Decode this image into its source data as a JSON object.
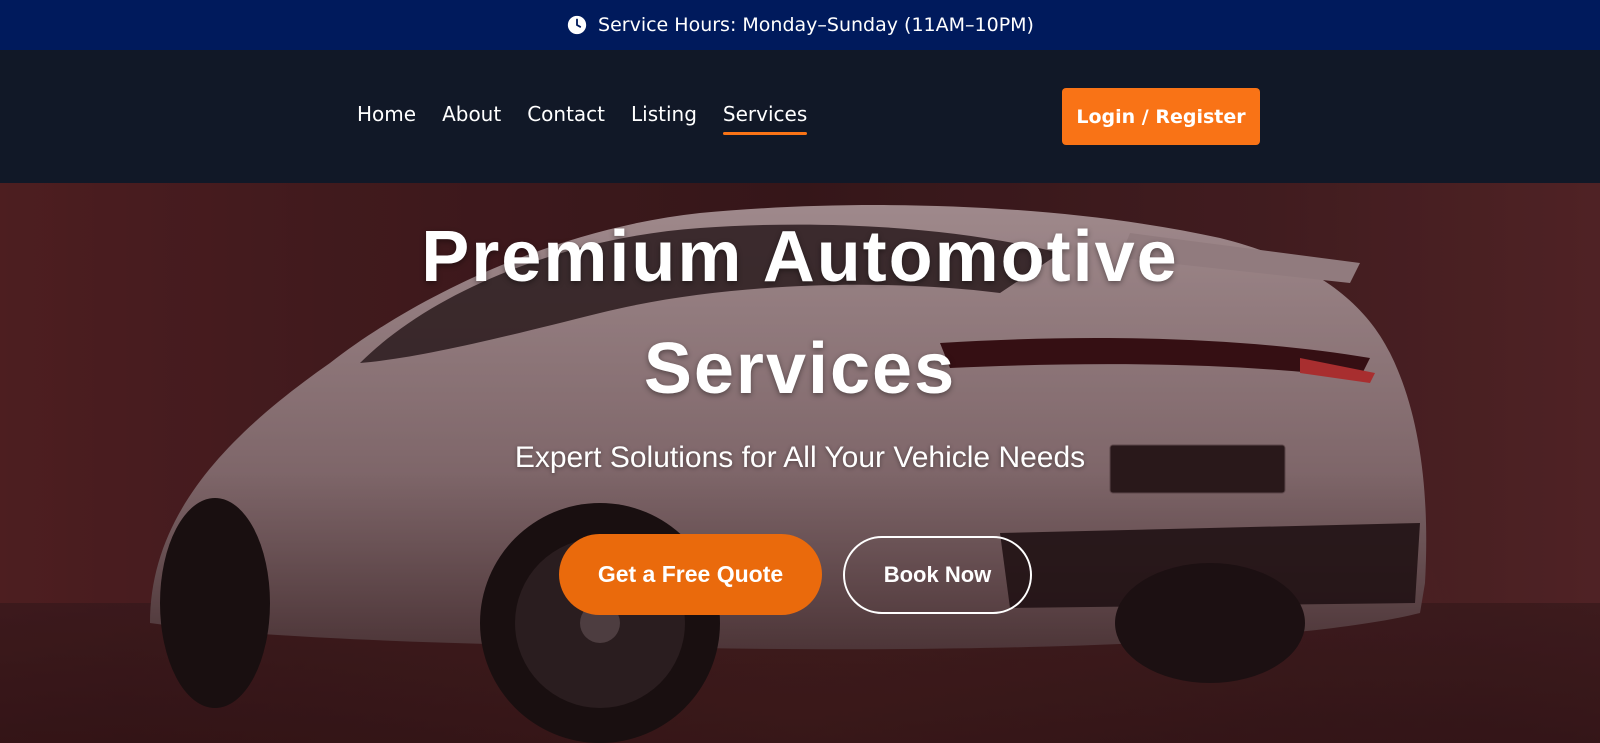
{
  "topbar": {
    "icon": "clock-icon",
    "text": "Service Hours: Monday–Sunday (11AM–10PM)"
  },
  "nav": {
    "links": [
      {
        "label": "Home"
      },
      {
        "label": "About"
      },
      {
        "label": "Contact"
      },
      {
        "label": "Listing"
      },
      {
        "label": "Services",
        "active": true
      }
    ],
    "login_label": "Login / Register"
  },
  "hero": {
    "title_line1": "Premium Automotive",
    "title_line2": "Services",
    "subtitle": "Expert Solutions for All Your Vehicle Needs",
    "quote_label": "Get a Free Quote",
    "book_label": "Book Now"
  },
  "colors": {
    "topbar_bg": "#001a5c",
    "nav_bg": "#111827",
    "accent": "#f97316",
    "cta": "#ea6a0c"
  }
}
